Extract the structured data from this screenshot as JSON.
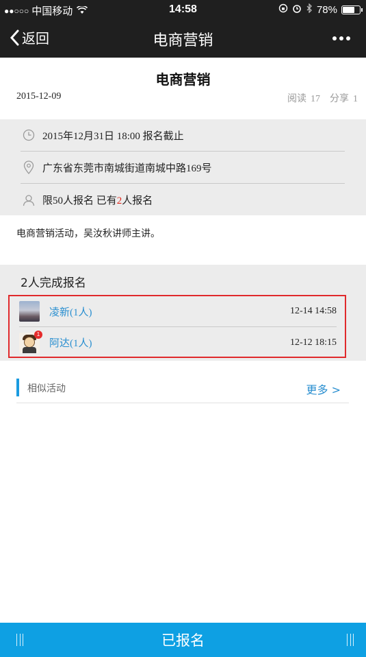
{
  "status_bar": {
    "signal_dots": "●●○○○",
    "carrier": "中国移动",
    "time": "14:58",
    "battery": "78%",
    "battery_level": 0.78
  },
  "nav": {
    "back_label": "返回",
    "title": "电商营销",
    "more_icon": "more-dots-icon"
  },
  "article": {
    "title": "电商营销",
    "date": "2015-12-09",
    "read_label": "阅读",
    "read_count": "17",
    "share_label": "分享",
    "share_count": "1"
  },
  "info": {
    "deadline": "2015年12月31日 18:00 报名截止",
    "address": "广东省东莞市南城街道南城中路169号",
    "limit_prefix": "限50人报名 已有",
    "limit_count": "2",
    "limit_suffix": "人报名"
  },
  "description": "电商营销活动，吴汝秋讲师主讲。",
  "signups": {
    "title": "2人完成报名",
    "items": [
      {
        "name": "凌新(1人)",
        "time": "12-14 14:58"
      },
      {
        "name": "阿达(1人)",
        "time": "12-12 18:15",
        "badge": "1"
      }
    ]
  },
  "similar": {
    "label": "相似活动",
    "more": "更多 >"
  },
  "bottom_bar": {
    "label": "已报名"
  },
  "colors": {
    "nav_bg": "#1f1f1f",
    "accent_blue": "#0ea0e3",
    "link_blue": "#2a8fd0",
    "highlight_red": "#e0292b"
  }
}
